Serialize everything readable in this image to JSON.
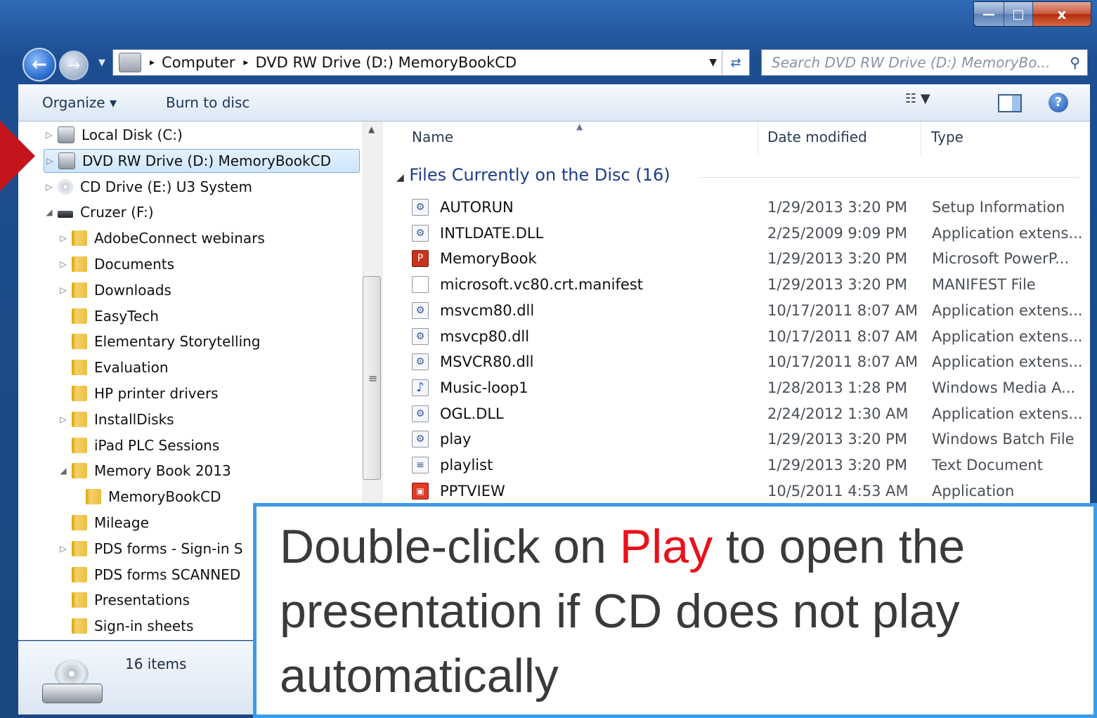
{
  "window": {
    "title_buttons": [
      "—",
      "□",
      "x"
    ]
  },
  "nav": {
    "back_icon": "back-arrow-icon",
    "forward_icon": "forward-arrow-icon",
    "address": [
      "Computer",
      "DVD RW Drive (D:) MemoryBookCD"
    ],
    "address_sep": "▸",
    "search_placeholder": "Search DVD RW Drive (D:) MemoryBo..."
  },
  "toolbar": {
    "organize": "Organize ▾",
    "burn": "Burn to disc"
  },
  "sidebar": {
    "items": [
      {
        "label": "Local Disk (C:)",
        "icon": "drive",
        "arrow": "▷"
      },
      {
        "label": "DVD RW Drive (D:) MemoryBookCD",
        "icon": "drive",
        "arrow": "▷",
        "selected": true
      },
      {
        "label": "CD Drive (E:) U3 System",
        "icon": "cd",
        "arrow": "▷"
      },
      {
        "label": "Cruzer (F:)",
        "icon": "usb",
        "arrow": "◢"
      },
      {
        "label": "AdobeConnect webinars",
        "icon": "folder",
        "arrow": "▷"
      },
      {
        "label": "Documents",
        "icon": "folder",
        "arrow": "▷"
      },
      {
        "label": "Downloads",
        "icon": "folder",
        "arrow": "▷"
      },
      {
        "label": "EasyTech",
        "icon": "folder",
        "arrow": ""
      },
      {
        "label": "Elementary Storytelling",
        "icon": "folder",
        "arrow": ""
      },
      {
        "label": "Evaluation",
        "icon": "folder",
        "arrow": ""
      },
      {
        "label": "HP printer drivers",
        "icon": "folder",
        "arrow": ""
      },
      {
        "label": "InstallDisks",
        "icon": "folder",
        "arrow": "▷"
      },
      {
        "label": "iPad PLC Sessions",
        "icon": "folder",
        "arrow": ""
      },
      {
        "label": "Memory Book 2013",
        "icon": "folder",
        "arrow": "◢"
      },
      {
        "label": "MemoryBookCD",
        "icon": "folder",
        "arrow": ""
      },
      {
        "label": "Mileage",
        "icon": "folder",
        "arrow": ""
      },
      {
        "label": "PDS forms - Sign-in S",
        "icon": "folder",
        "arrow": "▷"
      },
      {
        "label": "PDS forms SCANNED",
        "icon": "folder",
        "arrow": ""
      },
      {
        "label": "Presentations",
        "icon": "folder",
        "arrow": ""
      },
      {
        "label": "Sign-in sheets",
        "icon": "folder",
        "arrow": ""
      }
    ]
  },
  "files": {
    "columns": [
      "Name",
      "Date modified",
      "Type"
    ],
    "group_label": "Files Currently on the Disc (16)",
    "rows": [
      {
        "name": "AUTORUN",
        "date": "1/29/2013 3:20 PM",
        "type": "Setup Information",
        "icon": "⚙"
      },
      {
        "name": "INTLDATE.DLL",
        "date": "2/25/2009 9:09 PM",
        "type": "Application extens...",
        "icon": "⚙"
      },
      {
        "name": "MemoryBook",
        "date": "1/29/2013 3:20 PM",
        "type": "Microsoft PowerP...",
        "icon": "P"
      },
      {
        "name": "microsoft.vc80.crt.manifest",
        "date": "1/29/2013 3:20 PM",
        "type": "MANIFEST File",
        "icon": ""
      },
      {
        "name": "msvcm80.dll",
        "date": "10/17/2011 8:07 AM",
        "type": "Application extens...",
        "icon": "⚙"
      },
      {
        "name": "msvcp80.dll",
        "date": "10/17/2011 8:07 AM",
        "type": "Application extens...",
        "icon": "⚙"
      },
      {
        "name": "MSVCR80.dll",
        "date": "10/17/2011 8:07 AM",
        "type": "Application extens...",
        "icon": "⚙"
      },
      {
        "name": "Music-loop1",
        "date": "1/28/2013 1:28 PM",
        "type": "Windows Media A...",
        "icon": "♪"
      },
      {
        "name": "OGL.DLL",
        "date": "2/24/2012 1:30 AM",
        "type": "Application extens...",
        "icon": "⚙"
      },
      {
        "name": "play",
        "date": "1/29/2013 3:20 PM",
        "type": "Windows Batch File",
        "icon": "⚙"
      },
      {
        "name": "playlist",
        "date": "1/29/2013 3:20 PM",
        "type": "Text Document",
        "icon": "≡"
      },
      {
        "name": "PPTVIEW",
        "date": "10/5/2011 4:53 AM",
        "type": "Application",
        "icon": "▣"
      }
    ]
  },
  "status": {
    "count": "16 items"
  },
  "callout": {
    "pre": "Double-click on ",
    "highlight": "Play",
    "post": " to open the presentation if CD does not play automatically",
    "highlight_color": "#e8121b"
  }
}
